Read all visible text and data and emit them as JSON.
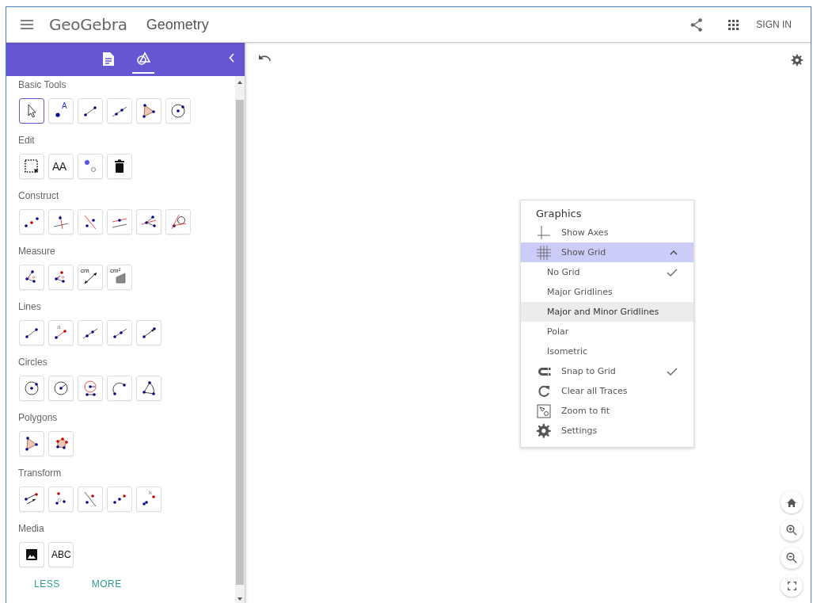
{
  "header": {
    "logo": "GeoGebra",
    "app_name": "Geometry",
    "sign_in": "SIGN IN"
  },
  "sidebar": {
    "tabs": [
      {
        "kind": "document",
        "selected": false
      },
      {
        "kind": "tools",
        "selected": true
      }
    ],
    "categories": [
      {
        "title": "Basic Tools",
        "tools": [
          {
            "kind": "move",
            "selected": true
          },
          {
            "kind": "point",
            "label": "A",
            "selected": false
          },
          {
            "kind": "segment",
            "selected": false
          },
          {
            "kind": "line",
            "selected": false
          },
          {
            "kind": "polygon",
            "selected": false
          },
          {
            "kind": "circle",
            "selected": false
          }
        ]
      },
      {
        "title": "Edit",
        "tools": [
          {
            "kind": "select",
            "selected": false
          },
          {
            "kind": "style",
            "label": "AA",
            "selected": false
          },
          {
            "kind": "showhide",
            "selected": false
          },
          {
            "kind": "delete",
            "selected": false
          }
        ]
      },
      {
        "title": "Construct",
        "tools": [
          {
            "kind": "midpoint",
            "selected": false
          },
          {
            "kind": "perpendicular",
            "selected": false
          },
          {
            "kind": "bisector",
            "selected": false
          },
          {
            "kind": "parallel",
            "selected": false
          },
          {
            "kind": "anglebisector",
            "selected": false
          },
          {
            "kind": "tangent",
            "selected": false
          }
        ]
      },
      {
        "title": "Measure",
        "tools": [
          {
            "kind": "angle",
            "selected": false
          },
          {
            "kind": "anglesize",
            "selected": false
          },
          {
            "kind": "distance",
            "label": "cm",
            "selected": false
          },
          {
            "kind": "area",
            "label": "cm²",
            "selected": false
          }
        ]
      },
      {
        "title": "Lines",
        "tools": [
          {
            "kind": "segment",
            "selected": false
          },
          {
            "kind": "seglength",
            "label": "a",
            "selected": false
          },
          {
            "kind": "line",
            "selected": false
          },
          {
            "kind": "ray",
            "selected": false
          },
          {
            "kind": "vector",
            "selected": false
          }
        ]
      },
      {
        "title": "Circles",
        "tools": [
          {
            "kind": "circle",
            "selected": false
          },
          {
            "kind": "circleradius",
            "selected": false
          },
          {
            "kind": "compass",
            "selected": false
          },
          {
            "kind": "arc",
            "selected": false
          },
          {
            "kind": "circumarc",
            "selected": false
          }
        ]
      },
      {
        "title": "Polygons",
        "tools": [
          {
            "kind": "polygon",
            "selected": false
          },
          {
            "kind": "regpolygon",
            "selected": false
          }
        ]
      },
      {
        "title": "Transform",
        "tools": [
          {
            "kind": "translate",
            "selected": false
          },
          {
            "kind": "rotate",
            "selected": false
          },
          {
            "kind": "reflectline",
            "selected": false
          },
          {
            "kind": "reflectpoint",
            "selected": false
          },
          {
            "kind": "dilate",
            "label": "k",
            "selected": false
          }
        ]
      },
      {
        "title": "Media",
        "tools": [
          {
            "kind": "image",
            "selected": false
          },
          {
            "kind": "text",
            "label": "ABC",
            "selected": false
          }
        ]
      }
    ],
    "less": "LESS",
    "more": "MORE"
  },
  "graphics_menu": {
    "title": "Graphics",
    "items": [
      {
        "kind": "axes",
        "label": "Show Axes"
      },
      {
        "kind": "grid",
        "label": "Show Grid",
        "expanded": true,
        "options": [
          {
            "label": "No Grid",
            "checked": true,
            "highlighted": false
          },
          {
            "label": "Major Gridlines",
            "checked": false,
            "highlighted": false
          },
          {
            "label": "Major and Minor Gridlines",
            "checked": false,
            "highlighted": true
          },
          {
            "label": "Polar",
            "checked": false,
            "highlighted": false
          },
          {
            "label": "Isometric",
            "checked": false,
            "highlighted": false
          }
        ]
      },
      {
        "kind": "snap",
        "label": "Snap to Grid",
        "checked": true
      },
      {
        "kind": "traces",
        "label": "Clear all Traces"
      },
      {
        "kind": "zoomfit",
        "label": "Zoom to fit"
      },
      {
        "kind": "settings",
        "label": "Settings"
      }
    ]
  }
}
